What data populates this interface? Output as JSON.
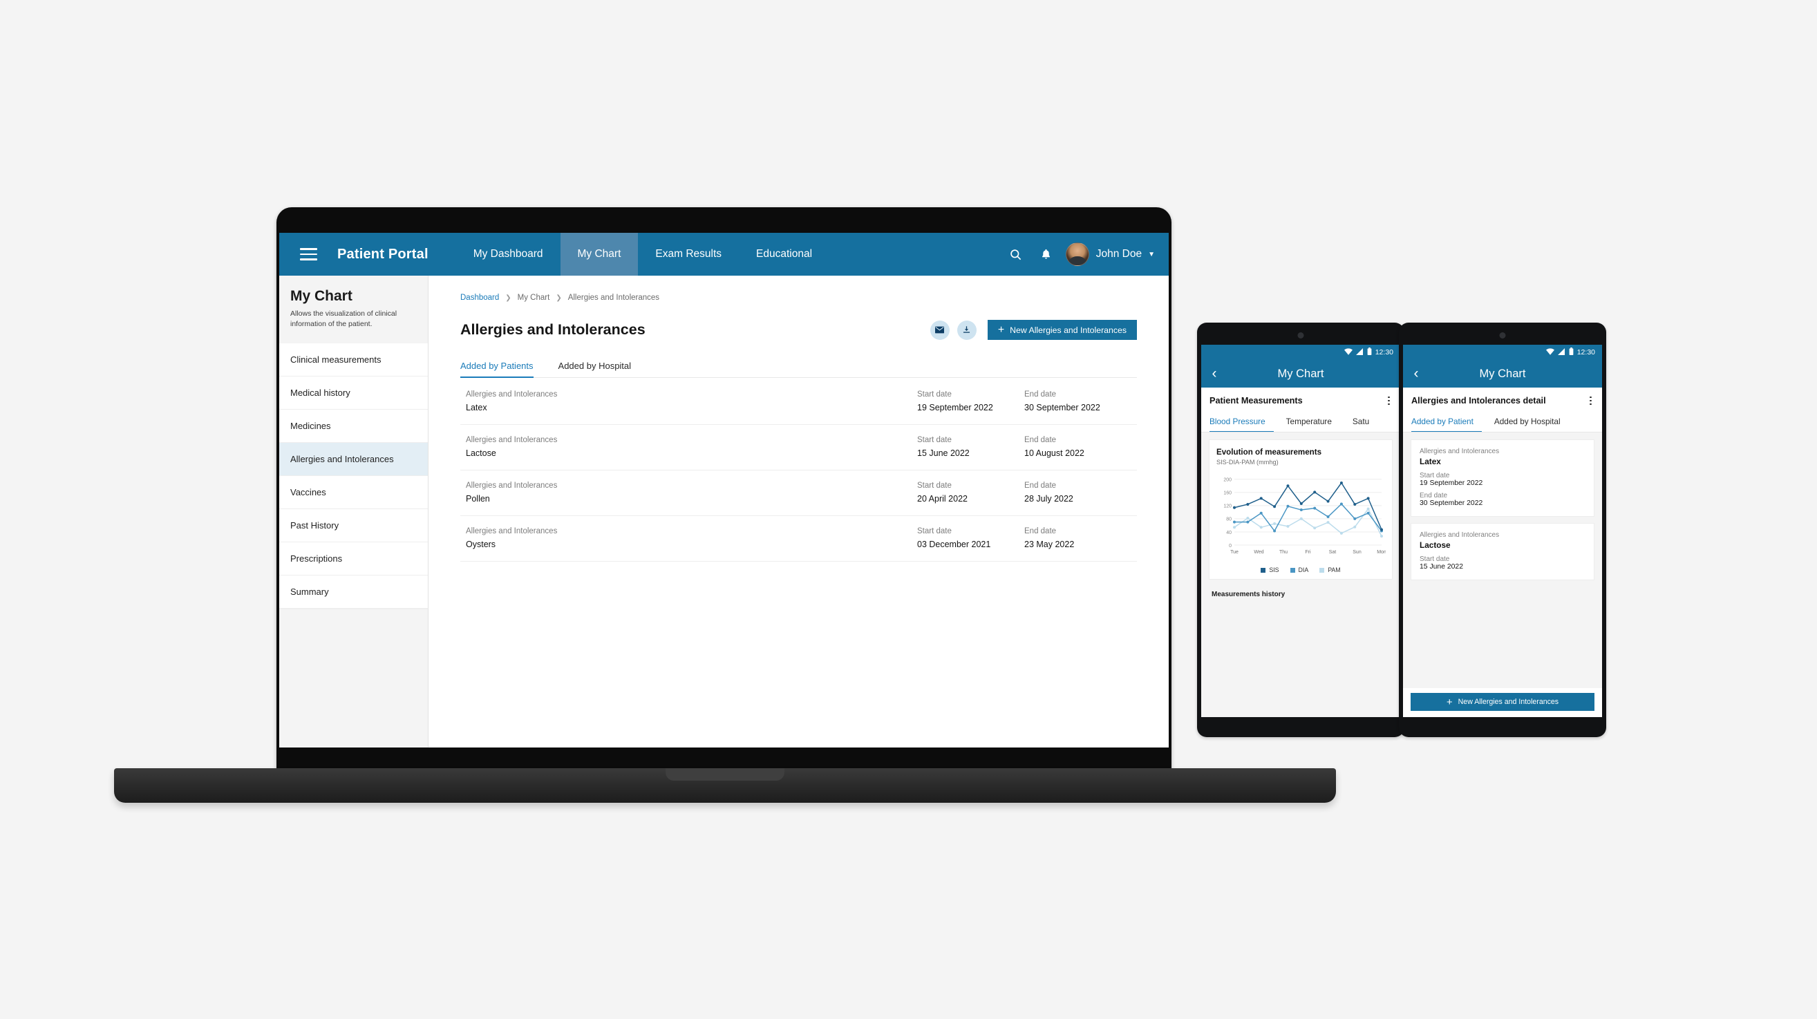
{
  "desktop": {
    "nav": {
      "menu_icon": "hamburger-icon",
      "brand": "Patient Portal",
      "items": [
        {
          "label": "My Dashboard",
          "active": false
        },
        {
          "label": "My Chart",
          "active": true
        },
        {
          "label": "Exam Results",
          "active": false
        },
        {
          "label": "Educational",
          "active": false
        }
      ],
      "search_icon": "search-icon",
      "bell_icon": "bell-icon",
      "avatar": "user-avatar",
      "username": "John Doe",
      "caret": "▼",
      "bar_color": "#15709f",
      "active_tab_color": "#4e87ad"
    },
    "sidebar": {
      "title": "My Chart",
      "subtitle": "Allows the visualization of clinical information of the patient.",
      "items": [
        {
          "label": "Clinical measurements",
          "active": false
        },
        {
          "label": "Medical history",
          "active": false
        },
        {
          "label": "Medicines",
          "active": false
        },
        {
          "label": "Allergies and Intolerances",
          "active": true
        },
        {
          "label": "Vaccines",
          "active": false
        },
        {
          "label": "Past History",
          "active": false
        },
        {
          "label": "Prescriptions",
          "active": false
        },
        {
          "label": "Summary",
          "active": false
        }
      ]
    },
    "breadcrumb": [
      {
        "label": "Dashboard",
        "link": true
      },
      {
        "label": "My Chart",
        "link": false
      },
      {
        "label": "Allergies and Intolerances",
        "link": false
      }
    ],
    "breadcrumb_separator": "❯",
    "page_title": "Allergies and Intolerances",
    "actions": {
      "mail_icon": "envelope-icon",
      "download_icon": "download-icon",
      "primary_button": "New Allergies and Intolerances",
      "plus": "+"
    },
    "tabs": [
      {
        "label": "Added by Patients",
        "active": true
      },
      {
        "label": "Added by Hospital",
        "active": false
      }
    ],
    "table": {
      "headers": {
        "name": "Allergies and Intolerances",
        "start": "Start date",
        "end": "End date"
      },
      "rows": [
        {
          "name": "Latex",
          "start": "19 September 2022",
          "end": "30  September 2022"
        },
        {
          "name": "Lactose",
          "start": "15 June 2022",
          "end": "10 August 2022"
        },
        {
          "name": "Pollen",
          "start": "20 April 2022",
          "end": "28 July 2022"
        },
        {
          "name": "Oysters",
          "start": "03 December 2021",
          "end": "23 May 2022"
        }
      ]
    }
  },
  "phone1": {
    "status": {
      "wifi": "wifi-icon",
      "signal": "signal-icon",
      "battery": "battery-icon",
      "time": "12:30"
    },
    "appbar": {
      "back": "‹",
      "title": "My Chart"
    },
    "sheet_title": "Patient Measurements",
    "kebab": "more-options-icon",
    "tabs": [
      {
        "label": "Blood Pressure",
        "active": true
      },
      {
        "label": "Temperature",
        "active": false
      },
      {
        "label": "Satu",
        "active": false
      }
    ],
    "history_label": "Measurements history"
  },
  "phone2": {
    "status": {
      "wifi": "wifi-icon",
      "signal": "signal-icon",
      "battery": "battery-icon",
      "time": "12:30"
    },
    "appbar": {
      "back": "‹",
      "title": "My Chart"
    },
    "sheet_title": "Allergies and Intolerances detail",
    "kebab": "more-options-icon",
    "tabs": [
      {
        "label": "Added by Patient",
        "active": true
      },
      {
        "label": "Added by Hospital",
        "active": false
      }
    ],
    "labels": {
      "type": "Allergies and Intolerances",
      "start": "Start date",
      "end": "End date"
    },
    "cards": [
      {
        "name": "Latex",
        "start": "19 September 2022",
        "end": "30 September 2022"
      },
      {
        "name": "Lactose",
        "start": "15 June 2022",
        "end": null
      }
    ],
    "fab": {
      "plus": "+",
      "label": "New Allergies and Intolerances"
    }
  },
  "chart_data": {
    "type": "line",
    "title": "Evolution of measurements",
    "subtitle": "SIS-DIA-PAM (mmhg)",
    "xlabel": "",
    "ylabel": "",
    "ylim": [
      0,
      210
    ],
    "yticks": [
      0,
      40,
      80,
      120,
      160,
      200
    ],
    "grid": true,
    "legend_position": "bottom",
    "categories": [
      "Tue",
      "Wed",
      "Thu",
      "Fri",
      "Sat",
      "Sun",
      "Mon"
    ],
    "x": [
      0,
      1,
      2,
      3,
      4,
      5,
      6,
      7,
      8,
      9,
      10,
      11,
      12,
      13,
      14
    ],
    "series": [
      {
        "name": "SIS",
        "color": "#1f5f8b",
        "values": [
          114,
          124,
          142,
          117,
          180,
          126,
          161,
          133,
          189,
          124,
          142,
          47
        ]
      },
      {
        "name": "DIA",
        "color": "#4a96c4",
        "values": [
          70,
          70,
          97,
          43,
          118,
          107,
          112,
          86,
          125,
          80,
          97,
          43
        ]
      },
      {
        "name": "PAM",
        "color": "#bcdcec",
        "values": [
          54,
          82,
          54,
          65,
          57,
          80,
          52,
          69,
          36,
          55,
          110,
          27
        ]
      }
    ]
  }
}
